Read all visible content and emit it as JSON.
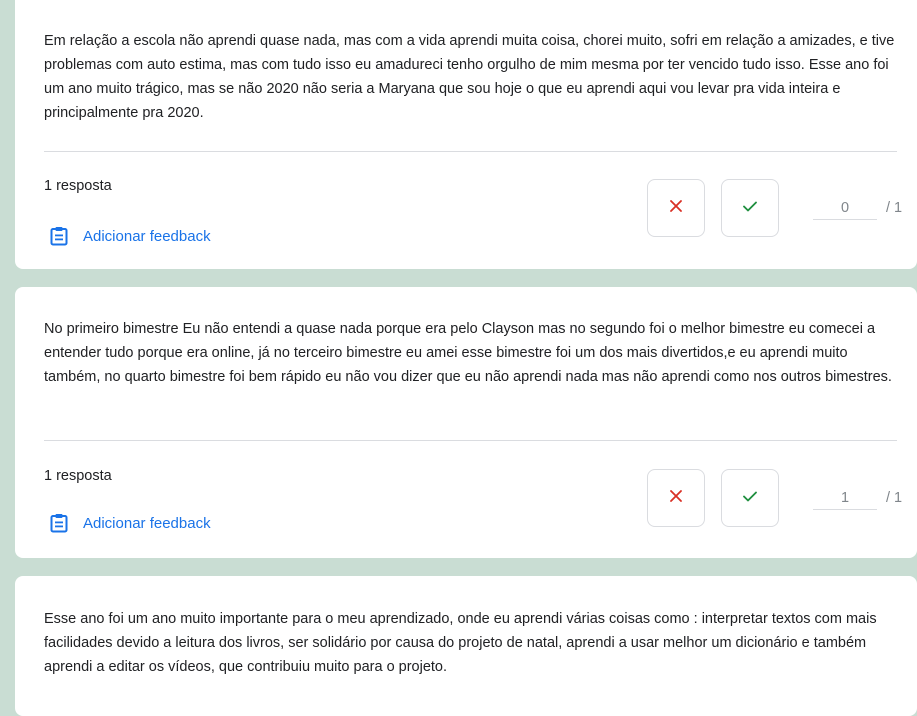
{
  "responses": [
    {
      "answer": "Em relação a escola não aprendi quase nada, mas com a vida aprendi muita coisa, chorei muito, sofri em relação a amizades, e tive problemas com auto estima, mas com tudo isso eu amadureci tenho orgulho de mim mesma por ter vencido tudo isso. Esse ano foi um ano muito trágico, mas se não 2020 não seria a Maryana que sou hoje o que eu aprendi aqui vou levar pra vida inteira e principalmente pra 2020.",
      "count_label": "1 resposta",
      "feedback_label": "Adicionar feedback",
      "score": "0",
      "total": "/ 1"
    },
    {
      "answer": "No primeiro bimestre Eu não entendi a quase nada porque era pelo Clayson mas no segundo foi o melhor bimestre eu comecei a entender tudo porque era online, já no terceiro bimestre eu amei esse bimestre foi um dos mais divertidos,e eu aprendi muito também, no quarto bimestre foi bem rápido eu não vou dizer que eu não aprendi nada mas não aprendi como nos outros bimestres.",
      "count_label": "1 resposta",
      "feedback_label": "Adicionar feedback",
      "score": "1",
      "total": "/ 1"
    },
    {
      "answer": "Esse ano foi um ano muito importante para o meu aprendizado, onde eu aprendi várias coisas como : interpretar textos com mais facilidades devido a leitura dos livros, ser solidário por causa do projeto de natal, aprendi a usar melhor um dicionário e também aprendi a editar os vídeos, que contribuiu muito para o projeto."
    }
  ],
  "icons": {
    "incorrect": "close-icon",
    "correct": "check-icon",
    "feedback": "clipboard-feedback-icon"
  },
  "colors": {
    "background": "#c9ddd3",
    "card": "#ffffff",
    "accent_blue": "#1a73e8",
    "incorrect_red": "#d93025",
    "correct_green": "#1e8e3e",
    "divider": "#dadce0",
    "muted_text": "#80868b"
  }
}
